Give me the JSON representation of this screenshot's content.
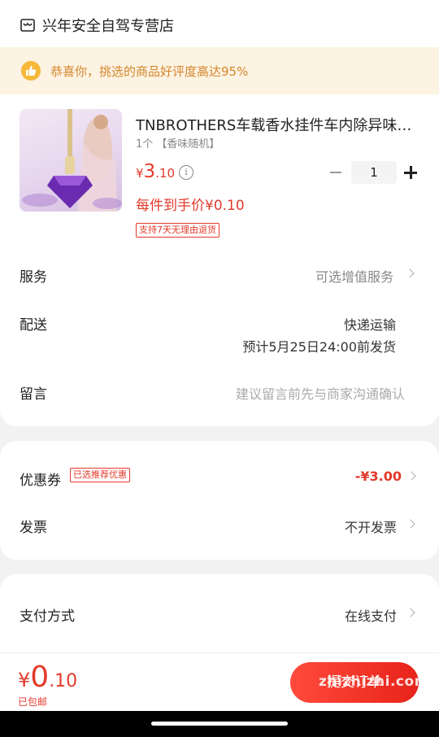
{
  "shop": {
    "name": "兴年安全自驾专营店",
    "icon": "store-icon"
  },
  "banner": {
    "text": "恭喜你，挑选的商品好评度高达95%",
    "icon": "thumbs-up-icon",
    "color": "#d2862c"
  },
  "product": {
    "title": "TNBROTHERS车载香水挂件车内除异味高...",
    "sku": "1个 【香味随机】",
    "price_symbol": "¥",
    "price_int": "3",
    "price_dec": ".10",
    "quantity": "1",
    "unit_price_text": "每件到手价¥0.10",
    "return_tag": "支持7天无理由退货"
  },
  "rows": {
    "service_label": "服务",
    "service_value": "可选增值服务",
    "delivery_label": "配送",
    "delivery_method": "快递运输",
    "delivery_eta": "预计5月25日24:00前发货",
    "note_label": "留言",
    "note_placeholder": "建议留言前先与商家沟通确认"
  },
  "coupon": {
    "label": "优惠券",
    "tag": "已选推荐优惠",
    "value": "-¥3.00",
    "invoice_label": "发票",
    "invoice_value": "不开发票"
  },
  "payment": {
    "label": "支付方式",
    "value": "在线支付"
  },
  "bottom": {
    "total_symbol": "¥",
    "total_int": "0",
    "total_dec": ".10",
    "shipping": "已包邮",
    "submit_label": "提交订单",
    "watermark": "zhizhizhi.com"
  },
  "colors": {
    "accent": "#e23a2b",
    "banner_bg": "#fdf3e2"
  }
}
